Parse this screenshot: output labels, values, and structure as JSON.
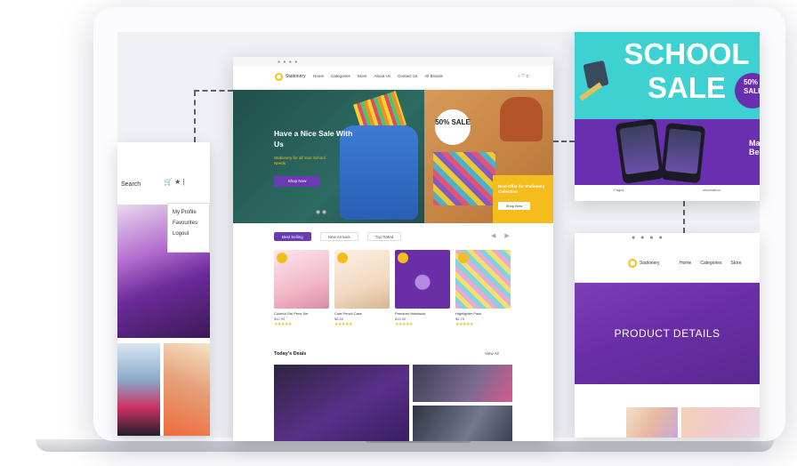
{
  "left_card": {
    "search_label": "Search",
    "dropdown": [
      "My Profile",
      "Favourites",
      "Logout"
    ]
  },
  "site": {
    "logo_text": "Stationery",
    "nav": [
      "Home",
      "Categories",
      "Store",
      "About Us",
      "Contact Us",
      "All Brands"
    ],
    "hero": {
      "title": "Have a Nice Sale With Us",
      "subtitle": "Stationery for all Your School Needs",
      "button": "Shop Now",
      "badge": "50% SALE",
      "promo": "Best Offer for Stationery Collection",
      "promo_button": "Shop Now"
    },
    "tabs": [
      "Best Selling",
      "New Arrivals",
      "Top Rated"
    ],
    "products": [
      {
        "name": "Colorful Gel Pens Set",
        "price": "$12.99",
        "stars": "★★★★★",
        "color": "#f2b8c6"
      },
      {
        "name": "Cute Pencil Case",
        "price": "$8.50",
        "stars": "★★★★★",
        "color": "#f1d9c0"
      },
      {
        "name": "Premium Notebook",
        "price": "$15.00",
        "stars": "★★★★★",
        "color": "#6a2fa6"
      },
      {
        "name": "Highlighter Pack",
        "price": "$6.75",
        "stars": "★★★★★",
        "color": "#e9a9d2"
      }
    ],
    "deals_title": "Today's Deals",
    "deals_view_all": "View All"
  },
  "right_card": {
    "banner_line1": "SCHOOL",
    "banner_line2": "SALE",
    "percent": "50%",
    "percent_sub": "SALE",
    "side_text": "Ma Be",
    "captions": [
      "Pages",
      "Information"
    ]
  },
  "product_details": {
    "logo_text": "Stationery",
    "links": [
      "Home",
      "Categories",
      "Store"
    ],
    "title": "PRODUCT DETAILS"
  },
  "colors": {
    "accent_purple": "#6a3bb3",
    "accent_yellow": "#f4bd1d",
    "hero_teal": "#2d6b62",
    "banner_cyan": "#3ed1d1"
  }
}
